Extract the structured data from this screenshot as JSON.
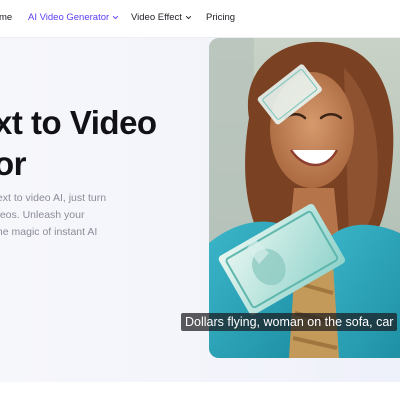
{
  "nav": {
    "items": [
      {
        "label": "me",
        "active": false,
        "has_dropdown": false
      },
      {
        "label": "AI Video Generator",
        "active": true,
        "has_dropdown": true
      },
      {
        "label": "Video Effect",
        "active": false,
        "has_dropdown": true
      },
      {
        "label": "Pricing",
        "active": false,
        "has_dropdown": false
      }
    ]
  },
  "hero": {
    "title_line1": "xt to Video",
    "title_line2": "or",
    "description_lines": [
      "text to video AI, just turn",
      "deos. Unleash your",
      "the magic of instant AI"
    ]
  },
  "video": {
    "caption": "Dollars flying, woman on the sofa, car"
  },
  "colors": {
    "accent": "#5b3ff5",
    "text": "#111116",
    "muted": "#8a8c98",
    "hero_bg": "#f4f5fb"
  }
}
